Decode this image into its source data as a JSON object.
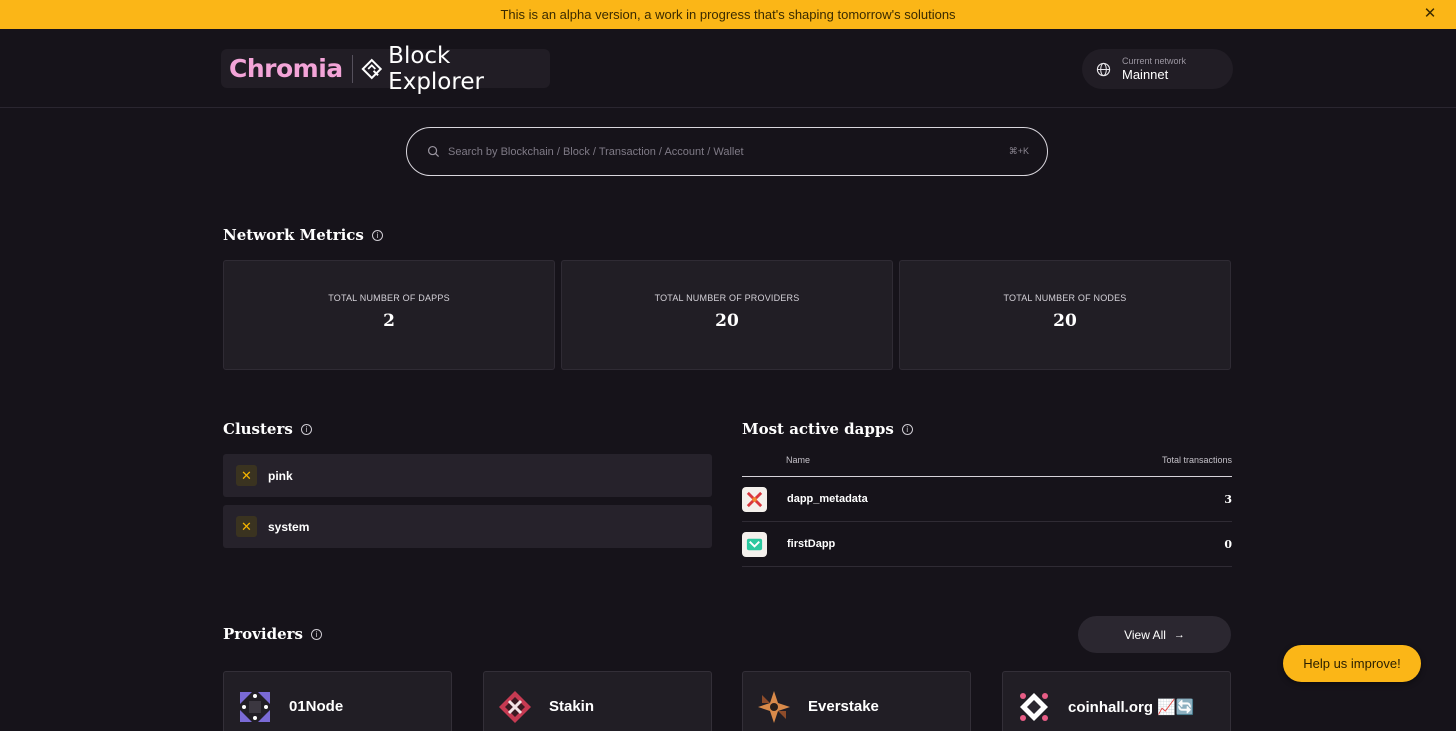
{
  "banner": {
    "text": "This is an alpha version, a work in progress that's shaping tomorrow's solutions",
    "close_glyph": "✕"
  },
  "header": {
    "brand": "Chromia",
    "product": "Block Explorer",
    "network": {
      "label": "Current network",
      "value": "Mainnet"
    }
  },
  "search": {
    "placeholder": "Search by Blockchain / Block / Transaction / Account / Wallet",
    "shortcut": "⌘+K"
  },
  "metrics": {
    "title": "Network Metrics",
    "cards": [
      {
        "label": "TOTAL NUMBER OF DAPPS",
        "value": "2"
      },
      {
        "label": "TOTAL NUMBER OF PROVIDERS",
        "value": "20"
      },
      {
        "label": "TOTAL NUMBER OF NODES",
        "value": "20"
      }
    ]
  },
  "clusters": {
    "title": "Clusters",
    "items": [
      {
        "name": "pink"
      },
      {
        "name": "system"
      }
    ]
  },
  "dapps": {
    "title": "Most active dapps",
    "col_name": "Name",
    "col_tx": "Total transactions",
    "rows": [
      {
        "name": "dapp_metadata",
        "tx": "3"
      },
      {
        "name": "firstDapp",
        "tx": "0"
      }
    ]
  },
  "providers": {
    "title": "Providers",
    "view_all": "View All",
    "items": [
      {
        "name": "01Node"
      },
      {
        "name": "Stakin"
      },
      {
        "name": "Everstake"
      },
      {
        "name": "coinhall.org 📈🔄"
      }
    ]
  },
  "help": {
    "label": "Help us improve!"
  },
  "colors": {
    "accent": "#fbb617",
    "background": "#16131a",
    "card": "#211e25",
    "brand_pink": "#f3a4d8"
  },
  "icons": {
    "banner_close": "close-icon",
    "network": "globe-icon",
    "search": "search-icon",
    "info": "info-icon",
    "cluster": "cluster-x-icon",
    "view_all": "arrow-right-icon"
  }
}
